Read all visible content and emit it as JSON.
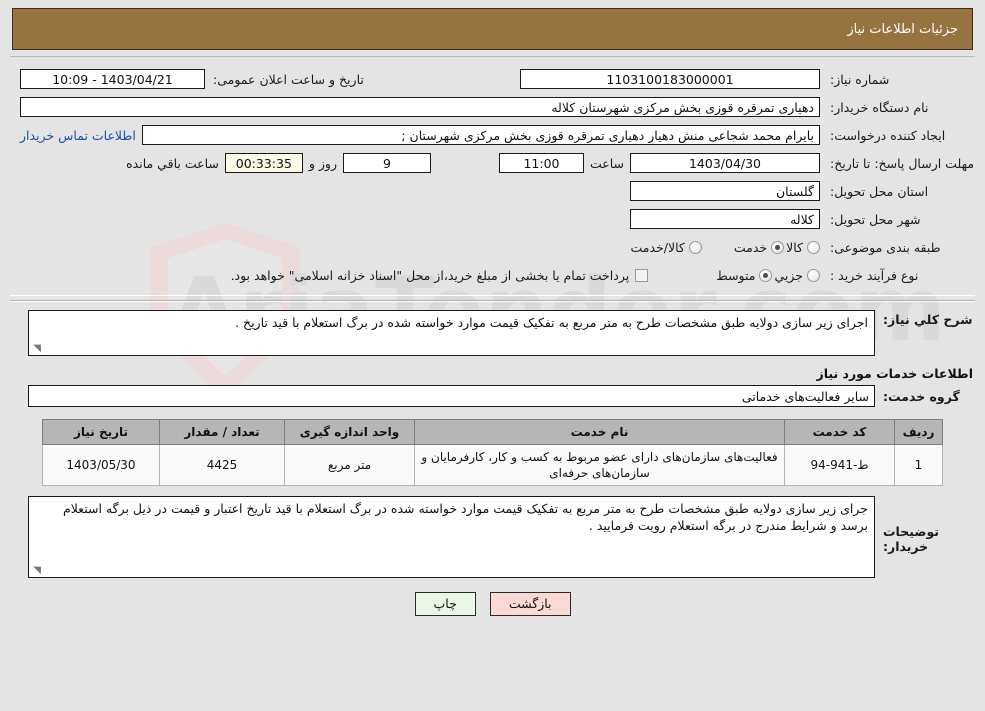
{
  "header": {
    "title": "جزئیات اطلاعات نیاز"
  },
  "watermark": {
    "text": "AriaTender.com"
  },
  "info": {
    "need_number_label": "شماره نیاز:",
    "need_number_value": "1103100183000001",
    "announce_label": "تاریخ و ساعت اعلان عمومی:",
    "announce_value": "1403/04/21 - 10:09",
    "buyer_org_label": "نام دستگاه خریدار:",
    "buyer_org_value": "دهیاری تمرقره قوزی بخش مرکزی شهرستان کلاله",
    "requester_label": "ایجاد کننده درخواست:",
    "requester_value": "بایرام محمد شجاعی منش دهیار دهیاری تمرقره قوزی بخش مرکزی شهرستان ;",
    "contact_link": "اطلاعات تماس خریدار",
    "deadline_label": "مهلت ارسال پاسخ: تا تاریخ:",
    "deadline_date": "1403/04/30",
    "hour_label": "ساعت",
    "deadline_time": "11:00",
    "days_value": "9",
    "days_unit_label": "روز و",
    "countdown_value": "00:33:35",
    "remaining_label": "ساعت باقي مانده",
    "province_label": "استان محل تحویل:",
    "province_value": "گلستان",
    "city_label": "شهر محل تحویل:",
    "city_value": "کلاله",
    "category_label": "طبقه بندی موضوعی:",
    "category_options": [
      {
        "label": "کالا",
        "selected": false
      },
      {
        "label": "خدمت",
        "selected": true
      },
      {
        "label": "کالا/خدمت",
        "selected": false
      }
    ],
    "process_label": "نوع فرآیند خرید :",
    "process_options": [
      {
        "label": "جزیي",
        "selected": false
      },
      {
        "label": "متوسط",
        "selected": true
      }
    ],
    "treasury_checkbox_checked": false,
    "treasury_note": "پرداخت تمام یا بخشی از مبلغ خرید،از محل \"اسناد خزانه اسلامی\" خواهد بود."
  },
  "description": {
    "label": "شرح کلي نياز:",
    "value": "اجرای زیر سازی دولایه طبق  مشخصات طرح به متر مربع به تفکیک قیمت موارد خواسته شده در برگ استعلام با قید تاریخ  ."
  },
  "services_section": {
    "title": "اطلاعات خدمات مورد نیاز",
    "group_label": "گروه خدمت:",
    "group_value": "سایر فعالیت‌های خدماتی"
  },
  "table": {
    "columns": [
      "ردیف",
      "کد خدمت",
      "نام خدمت",
      "واحد اندازه گیری",
      "تعداد / مقدار",
      "تاریخ نیاز"
    ],
    "rows": [
      {
        "row_no": "1",
        "service_code": "ط-941-94",
        "service_name": "فعالیت‌های سازمان‌های دارای عضو مربوط به کسب و کار، کارفرمایان و سازمان‌های حرفه‌ای",
        "unit": "متر مربع",
        "quantity": "4425",
        "need_date": "1403/05/30"
      }
    ]
  },
  "buyer_notes": {
    "label": "توضیحات خریدار:",
    "value": "جرای زیر سازی دولایه طبق  مشخصات طرح به متر مربع به تفکیک قیمت موارد خواسته شده در برگ استعلام با قید تاریخ اعتبار و قیمت در ذیل برگه استعلام برسد و شرایط مندرج در برگه استعلام رویت فرمایید ."
  },
  "buttons": {
    "print": "چاپ",
    "back": "بازگشت"
  },
  "colors": {
    "titlebar": "#97743f",
    "link": "#1b4fa8",
    "print_btn": "#eaf6e6",
    "back_btn": "#fbd9d4",
    "header_row": "#b6b6b6"
  }
}
